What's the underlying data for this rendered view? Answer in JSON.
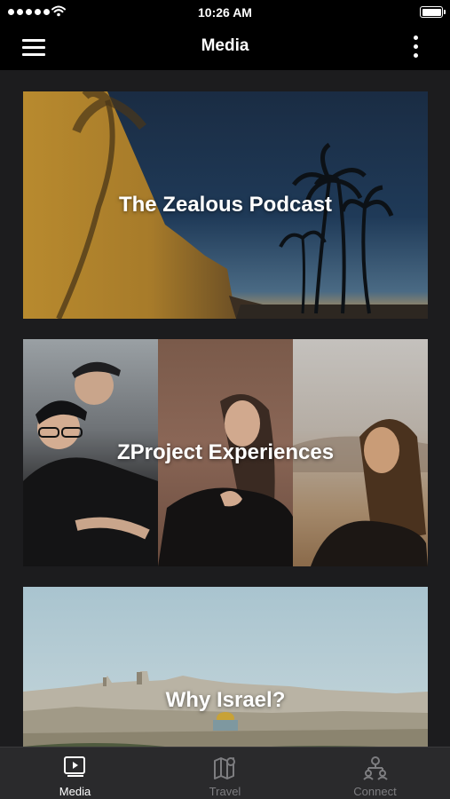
{
  "status": {
    "time": "10:26 AM"
  },
  "nav": {
    "title": "Media"
  },
  "cards": [
    {
      "title": "The Zealous Podcast"
    },
    {
      "title": "ZProject Experiences"
    },
    {
      "title": "Why Israel?"
    }
  ],
  "tabs": [
    {
      "label": "Media",
      "icon": "media-icon",
      "active": true
    },
    {
      "label": "Travel",
      "icon": "map-icon",
      "active": false
    },
    {
      "label": "Connect",
      "icon": "connect-icon",
      "active": false
    }
  ],
  "colors": {
    "active_tab": "#ffffff",
    "inactive_tab": "#7d7d80",
    "background": "#1c1c1e",
    "bar": "#000000"
  }
}
